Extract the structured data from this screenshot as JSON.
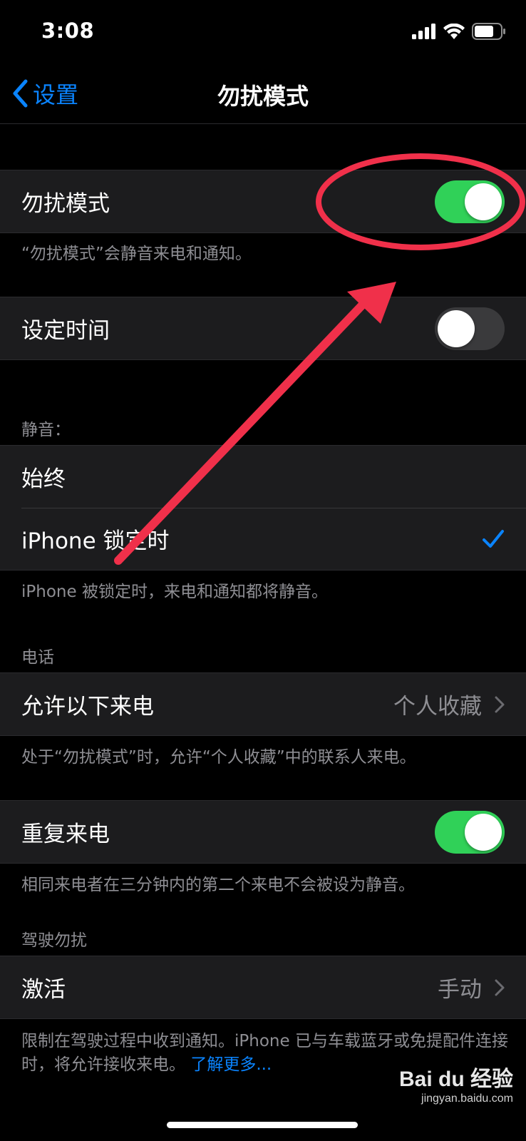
{
  "status_bar": {
    "time": "3:08"
  },
  "nav": {
    "back_label": "设置",
    "title": "勿扰模式"
  },
  "dnd": {
    "label": "勿扰模式",
    "toggle_on": true,
    "footer": "“勿扰模式”会静音来电和通知。"
  },
  "scheduled": {
    "label": "设定时间",
    "toggle_on": false
  },
  "silence": {
    "header": "静音：",
    "options": [
      {
        "label": "始终",
        "selected": false
      },
      {
        "label": "iPhone 锁定时",
        "selected": true
      }
    ],
    "footer": "iPhone 被锁定时，来电和通知都将静音。"
  },
  "phone": {
    "header": "电话",
    "allow_calls_label": "允许以下来电",
    "allow_calls_value": "个人收藏",
    "footer": "处于“勿扰模式”时，允许“个人收藏”中的联系人来电。"
  },
  "repeated_calls": {
    "label": "重复来电",
    "toggle_on": true,
    "footer": "相同来电者在三分钟内的第二个来电不会被设为静音。"
  },
  "driving": {
    "header": "驾驶勿扰",
    "activate_label": "激活",
    "activate_value": "手动",
    "footer": "限制在驾驶过程中收到通知。iPhone 已与车载蓝牙或免提配件连接时，将允许接收来电。",
    "learn_more": "了解更多..."
  },
  "watermark": {
    "brand": "Bai du 经验",
    "url": "jingyan.baidu.com"
  },
  "colors": {
    "accent": "#0a84ff",
    "toggle_on": "#30d158",
    "annotation_red": "#f0304a"
  }
}
